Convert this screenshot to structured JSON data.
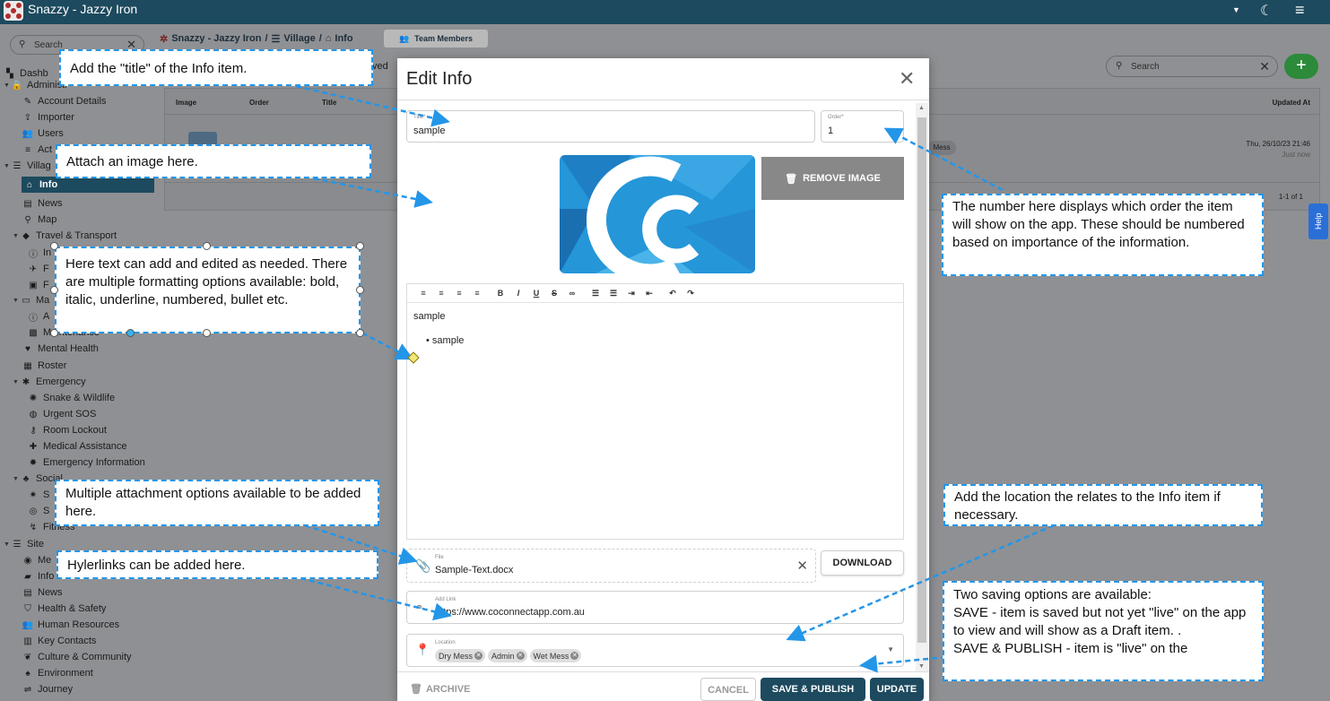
{
  "topbar": {
    "app_title": "Snazzy - Jazzy Iron"
  },
  "sidebar": {
    "search_placeholder": "Search",
    "items": [
      {
        "label": "Dashb",
        "icon": "dashboard-icon"
      },
      {
        "label": "Administr",
        "icon": "lock-icon"
      },
      {
        "label": "Account Details",
        "icon": "pencil-icon"
      },
      {
        "label": "Importer",
        "icon": "upload-icon"
      },
      {
        "label": "Users",
        "icon": "users-icon"
      },
      {
        "label": "Act",
        "icon": "list-icon"
      },
      {
        "label": "Villag",
        "icon": "checklist-icon"
      },
      {
        "label": "Info",
        "icon": "library-icon"
      },
      {
        "label": "News",
        "icon": "news-icon"
      },
      {
        "label": "Map",
        "icon": "pin-icon"
      },
      {
        "label": "Travel & Transport",
        "icon": "diamond-icon"
      },
      {
        "label": "In",
        "icon": "info-icon"
      },
      {
        "label": "F",
        "icon": "plane-icon"
      },
      {
        "label": "F",
        "icon": "bus-icon"
      },
      {
        "label": "Ma",
        "icon": "laptop-icon"
      },
      {
        "label": "A",
        "icon": "info-icon"
      },
      {
        "label": "Maintenance",
        "icon": "toolbox-icon"
      },
      {
        "label": "Mental Health",
        "icon": "hands-heart-icon"
      },
      {
        "label": "Roster",
        "icon": "calendar-icon"
      },
      {
        "label": "Emergency",
        "icon": "asterisk-icon"
      },
      {
        "label": "Snake & Wildlife",
        "icon": "bug-icon"
      },
      {
        "label": "Urgent SOS",
        "icon": "alarm-icon"
      },
      {
        "label": "Room Lockout",
        "icon": "key-icon"
      },
      {
        "label": "Medical Assistance",
        "icon": "medkit-icon"
      },
      {
        "label": "Emergency Information",
        "icon": "fire-icon"
      },
      {
        "label": "Social",
        "icon": "group-icon"
      },
      {
        "label": "S",
        "icon": "sparkle-icon"
      },
      {
        "label": "S",
        "icon": "ball-icon"
      },
      {
        "label": "Fitness",
        "icon": "run-icon"
      },
      {
        "label": "Site",
        "icon": "checklist-icon"
      },
      {
        "label": "Me",
        "icon": "meal-icon"
      },
      {
        "label": "Info",
        "icon": "car-icon"
      },
      {
        "label": "News",
        "icon": "news-icon"
      },
      {
        "label": "Health & Safety",
        "icon": "shield-icon"
      },
      {
        "label": "Human Resources",
        "icon": "users-icon"
      },
      {
        "label": "Key Contacts",
        "icon": "contact-card-icon"
      },
      {
        "label": "Culture & Community",
        "icon": "community-icon"
      },
      {
        "label": "Environment",
        "icon": "tree-icon"
      },
      {
        "label": "Journey",
        "icon": "signpost-icon"
      }
    ]
  },
  "breadcrumb": {
    "app": "Snazzy - Jazzy Iron",
    "sep": "/",
    "section": "Village",
    "page": "Info"
  },
  "team_members_label": "Team Members",
  "background": {
    "approved_text": "ved",
    "search_placeholder": "Search",
    "table_headers": [
      "Image",
      "Order",
      "Title",
      "Updated At"
    ],
    "row_chip": "Mess",
    "row_updated": "Thu, 26/10/23 21:46",
    "row_updated_sub": "Just now",
    "pager": "1-1 of 1"
  },
  "help_label": "Help",
  "modal": {
    "title": "Edit Info",
    "title_field": {
      "label": "Title*",
      "value": "sample"
    },
    "order_field": {
      "label": "Order*",
      "value": "1"
    },
    "remove_image_label": "REMOVE IMAGE",
    "editor": {
      "toolbar": [
        "align-left-icon",
        "align-center-icon",
        "align-right-icon",
        "justify-icon",
        "bold-icon",
        "italic-icon",
        "underline-icon",
        "strikethrough-icon",
        "link-icon",
        "bullet-list-icon",
        "numbered-list-icon",
        "indent-icon",
        "outdent-icon",
        "undo-icon",
        "redo-icon"
      ],
      "paragraph": "sample",
      "bullet": "sample"
    },
    "file_field": {
      "label": "File",
      "value": "Sample-Text.docx"
    },
    "download_label": "DOWNLOAD",
    "link_field": {
      "label": "Add Link",
      "value": "https://www.coconnectapp.com.au"
    },
    "location_field": {
      "label": "Location",
      "chips": [
        "Dry Mess",
        "Admin",
        "Wet Mess"
      ]
    },
    "archive_label": "ARCHIVE",
    "cancel_label": "CANCEL",
    "save_publish_label": "SAVE & PUBLISH",
    "update_label": "UPDATE"
  },
  "callouts": {
    "title": "Add the \"title\" of the Info item.",
    "image": "Attach an image here.",
    "text": "Here text can add and edited as needed. There are multiple formatting options available: bold, italic, underline, numbered, bullet etc.",
    "order": "The number here displays which order the item will show on the app. These should be numbered based on importance of the information.",
    "attachment": "Multiple attachment options available to be added here.",
    "location": "Add the location the relates to the Info item if necessary.",
    "hyperlink": "Hylerlinks can be added here.",
    "saving": "Two saving options are available:\nSAVE - item is saved but not yet \"live\" on the app to view and will show as a Draft item. .\nSAVE & PUBLISH - item is \"live\" on the"
  },
  "colors": {
    "topbar": "#1d4a5e",
    "callout_border": "#2496e8",
    "primary_button": "#1d4a5e",
    "add_button": "#2c8a3a"
  }
}
